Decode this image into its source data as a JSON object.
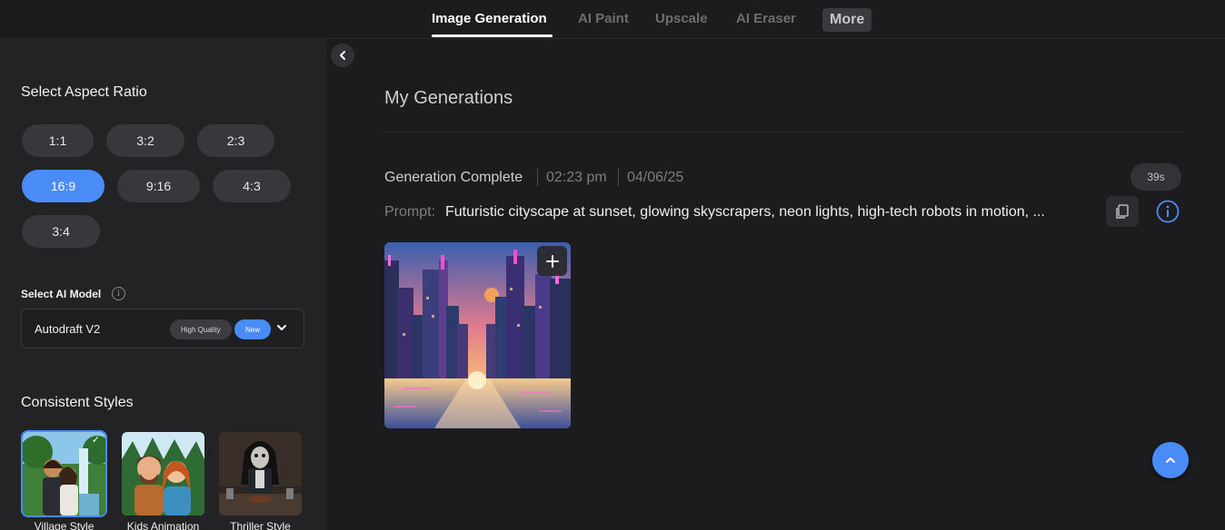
{
  "nav": {
    "tabs": [
      {
        "label": "Image Generation",
        "active": true
      },
      {
        "label": "AI Paint",
        "active": false
      },
      {
        "label": "Upscale",
        "active": false
      },
      {
        "label": "AI Eraser",
        "active": false
      }
    ],
    "more_label": "More"
  },
  "sidebar": {
    "aspect_title": "Select Aspect Ratio",
    "ratios": [
      "1:1",
      "3:2",
      "2:3",
      "16:9",
      "9:16",
      "4:3",
      "3:4"
    ],
    "selected_ratio": "16:9",
    "model_label": "Select AI Model",
    "model": {
      "name": "Autodraft V2",
      "badge_quality": "High Quality",
      "badge_new": "New"
    },
    "styles_title": "Consistent Styles",
    "styles": [
      {
        "label": "Village Style",
        "selected": true
      },
      {
        "label": "Kids Animation",
        "selected": false
      },
      {
        "label": "Thriller Style",
        "selected": false
      }
    ]
  },
  "main": {
    "title": "My Generations",
    "status": "Generation Complete",
    "time": "02:23 pm",
    "date": "04/06/25",
    "duration": "39s",
    "prompt_label": "Prompt:",
    "prompt_text": "Futuristic cityscape at sunset, glowing skyscrapers, neon lights, high-tech robots in motion, ..."
  },
  "colors": {
    "accent": "#4a8cf7",
    "background": "#1c1c1f",
    "sidebar": "#232326"
  },
  "icons": [
    "chevron-left-icon",
    "info-icon",
    "chevron-down-icon",
    "copy-icon",
    "plus-icon",
    "chevron-up-icon",
    "check-icon"
  ]
}
